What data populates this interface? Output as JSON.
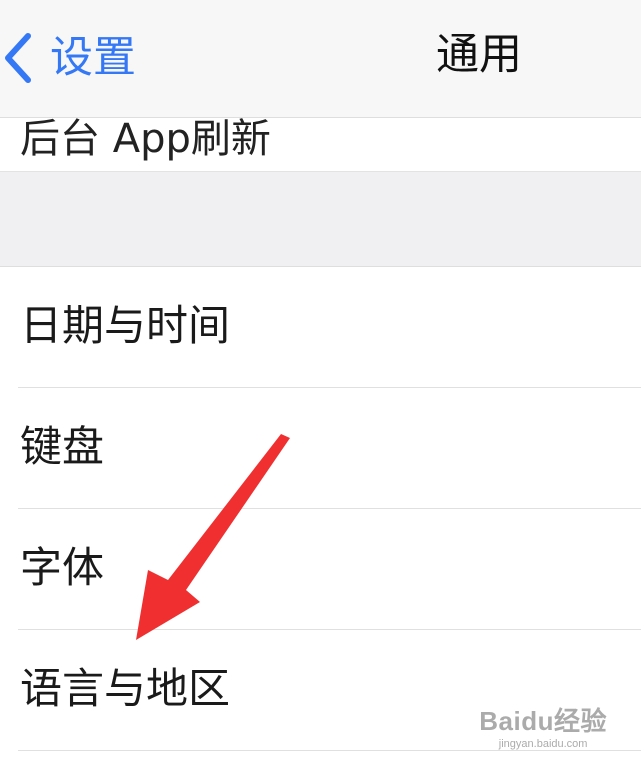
{
  "nav": {
    "back_label": "设置",
    "title": "通用"
  },
  "partial_row": {
    "label": "后台 App刷新"
  },
  "rows": [
    {
      "label": "日期与时间"
    },
    {
      "label": "键盘"
    },
    {
      "label": "字体"
    },
    {
      "label": "语言与地区"
    }
  ],
  "annotation": {
    "color": "#f03030"
  },
  "watermark": {
    "brand": "Baidu经验",
    "url": "jingyan.baidu.com"
  },
  "colors": {
    "accent": "#3478f6"
  }
}
